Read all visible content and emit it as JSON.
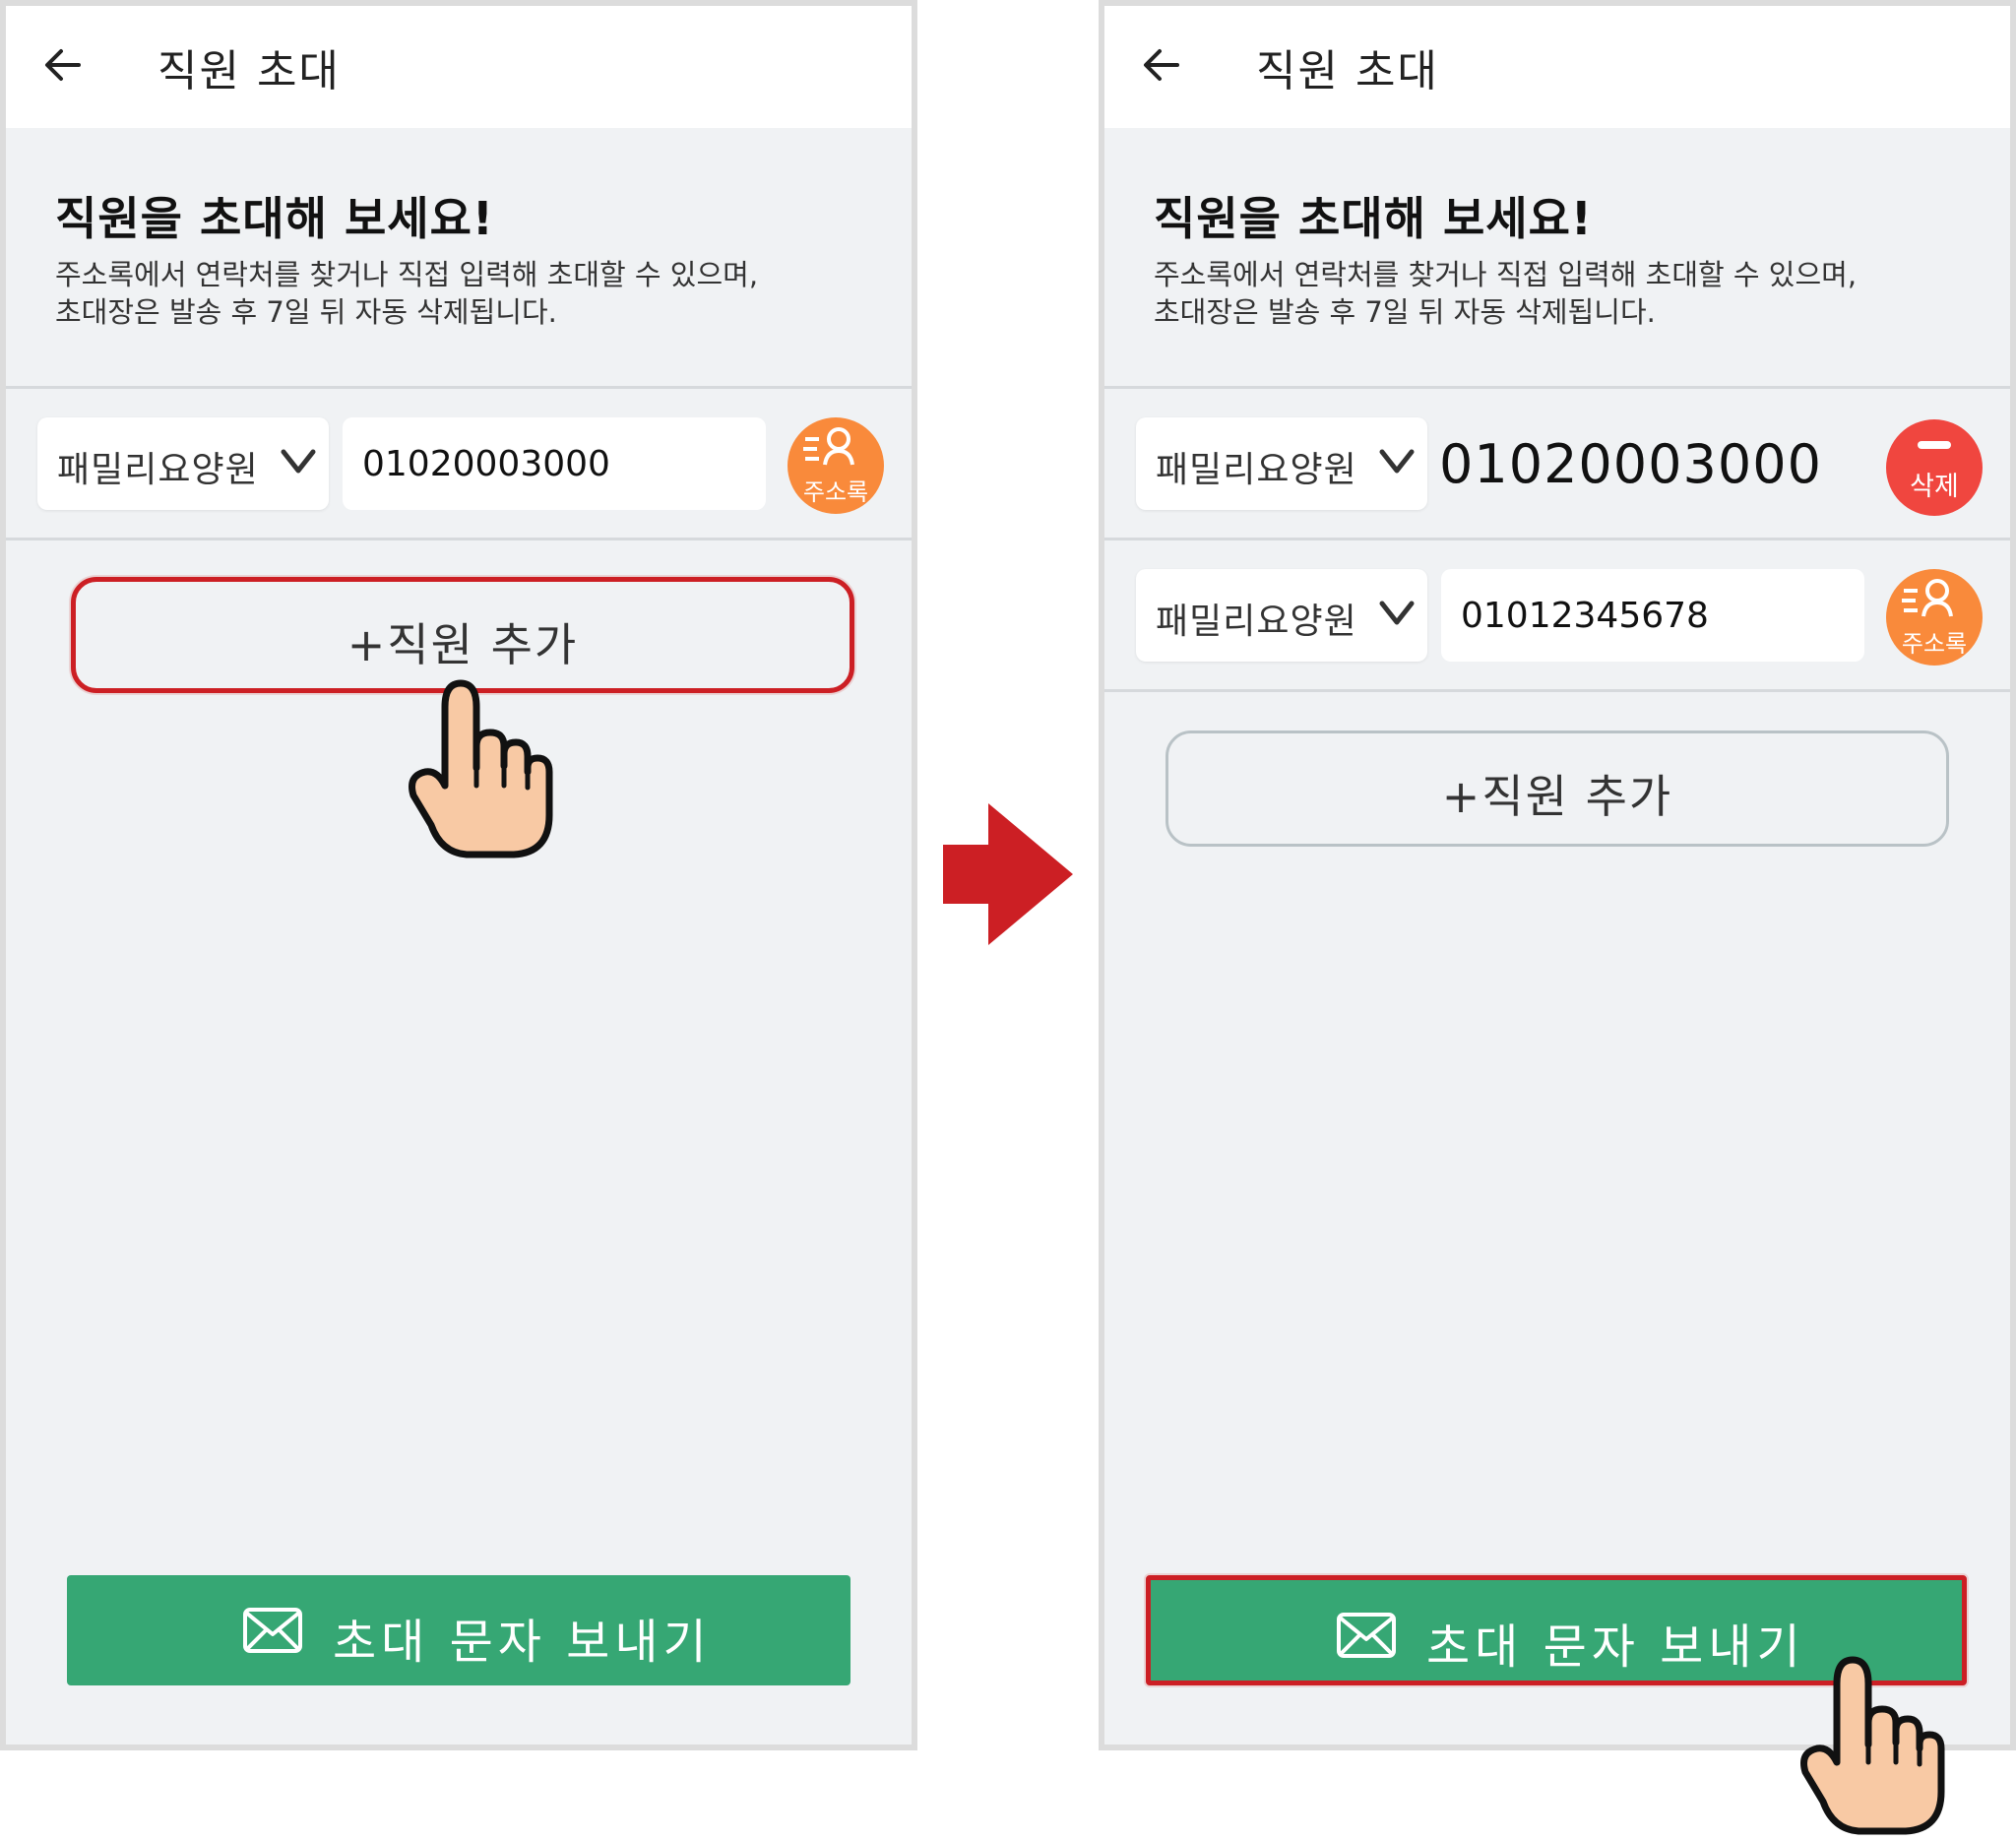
{
  "screens": [
    {
      "header": {
        "title": "직원 초대"
      },
      "intro": {
        "title": "직원을 초대해 보세요!",
        "desc_line1": "주소록에서 연락처를 찾거나 직접 입력해 초대할 수 있으며,",
        "desc_line2": "초대장은 발송 후 7일 뒤 자동 삭제됩니다."
      },
      "rows": [
        {
          "facility": "패밀리요양원",
          "phone": "01020003000",
          "action_label": "주소록"
        }
      ],
      "add_button": "+직원 추가",
      "send_button": "초대 문자 보내기"
    },
    {
      "header": {
        "title": "직원 초대"
      },
      "intro": {
        "title": "직원을 초대해 보세요!",
        "desc_line1": "주소록에서 연락처를 찾거나 직접 입력해 초대할 수 있으며,",
        "desc_line2": "초대장은 발송 후 7일 뒤 자동 삭제됩니다."
      },
      "rows": [
        {
          "facility": "패밀리요양원",
          "phone": "01020003000",
          "action_label": "삭제"
        },
        {
          "facility": "패밀리요양원",
          "phone": "01012345678",
          "action_label": "주소록"
        }
      ],
      "add_button": "+직원 추가",
      "send_button": "초대 문자 보내기"
    }
  ],
  "colors": {
    "accent_green": "#36a774",
    "highlight_red": "#cc1f24",
    "address_book_orange": "#f98a3b",
    "delete_red": "#f0463f",
    "background_gray": "#f0f2f4"
  },
  "icons": [
    "back-arrow-icon",
    "chevron-down-icon",
    "contacts-icon",
    "minus-icon",
    "mail-icon",
    "pointing-hand-icon",
    "next-step-arrow-icon"
  ]
}
